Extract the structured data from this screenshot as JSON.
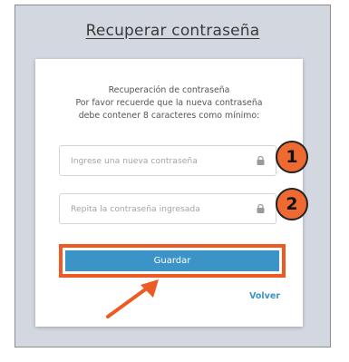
{
  "page": {
    "title": "Recuperar contraseña"
  },
  "card": {
    "info_lines": [
      "Recuperación de contraseña",
      "Por favor recuerde que la nueva contraseña",
      "debe contener 8 caracteres como mínimo:"
    ],
    "new_password": {
      "placeholder": "Ingrese una nueva contraseña",
      "value": ""
    },
    "repeat_password": {
      "placeholder": "Repita la contraseña ingresada",
      "value": ""
    },
    "save_label": "Guardar",
    "back_label": "Volver"
  },
  "annotations": {
    "badge_1": "1",
    "badge_2": "2",
    "accent_color": "#ee6a31",
    "button_color": "#3b93c7"
  },
  "icons": [
    "lock-icon",
    "arrow-icon"
  ]
}
